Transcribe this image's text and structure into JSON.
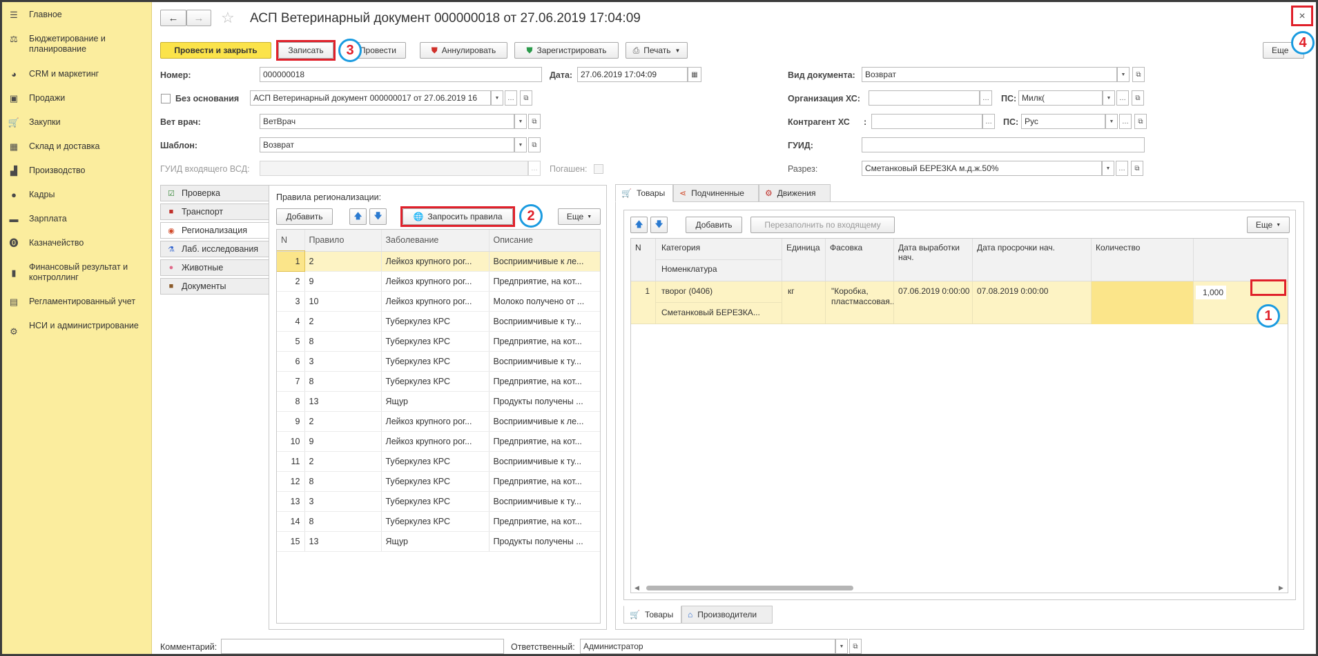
{
  "sidebar": {
    "items": [
      {
        "label": "Главное",
        "icon": "menu-icon"
      },
      {
        "label": "Бюджетирование и планирование",
        "icon": "budget-icon"
      },
      {
        "label": "CRM и маркетинг",
        "icon": "crm-icon"
      },
      {
        "label": "Продажи",
        "icon": "sales-icon"
      },
      {
        "label": "Закупки",
        "icon": "cart-icon"
      },
      {
        "label": "Склад и доставка",
        "icon": "warehouse-icon"
      },
      {
        "label": "Производство",
        "icon": "factory-icon"
      },
      {
        "label": "Кадры",
        "icon": "personnel-icon"
      },
      {
        "label": "Зарплата",
        "icon": "salary-icon"
      },
      {
        "label": "Казначейство",
        "icon": "treasury-icon"
      },
      {
        "label": "Финансовый результат и контроллинг",
        "icon": "finance-icon"
      },
      {
        "label": "Регламентированный учет",
        "icon": "accounting-icon"
      },
      {
        "label": "НСИ и администрирование",
        "icon": "gear-icon"
      }
    ]
  },
  "header": {
    "title": "АСП Ветеринарный документ 000000018 от 27.06.2019 17:04:09",
    "close": "×"
  },
  "toolbar": {
    "post_close": "Провести и закрыть",
    "save": "Записать",
    "post": "Провести",
    "annul": "Аннулировать",
    "register": "Зарегистрировать",
    "print": "Печать",
    "more": "Еще"
  },
  "form": {
    "number_label": "Номер:",
    "number": "000000018",
    "date_label": "Дата:",
    "date": "27.06.2019 17:04:09",
    "no_basis_label": "Без основания",
    "basis": "АСП Ветеринарный документ 000000017 от 27.06.2019 16",
    "vet_label": "Вет врач:",
    "vet": "ВетВрач",
    "template_label": "Шаблон:",
    "template": "Возврат",
    "guid_in_label": "ГУИД входящего ВСД:",
    "guid_in": "",
    "paid_label": "Погашен:",
    "doc_type_label": "Вид документа:",
    "doc_type": "Возврат",
    "org_label": "Организация ХС:",
    "org": "",
    "ps_label": "ПС:",
    "org_ps": "Милк(",
    "contr_label": "Контрагент ХС",
    "contr_colon": ":",
    "contr": "",
    "contr_ps": "Рус",
    "guid_label": "ГУИД:",
    "guid": "",
    "cut_label": "Разрез:",
    "cut": "Сметанковый БЕРЕЗКА м.д.ж.50%",
    "comment_label": "Комментарий:",
    "comment": "",
    "resp_label": "Ответственный:",
    "resp": "Администратор"
  },
  "left_tabs": [
    {
      "label": "Проверка",
      "icon": "check-icon",
      "color": "#3a8a3a"
    },
    {
      "label": "Транспорт",
      "icon": "truck-icon",
      "color": "#c0302a"
    },
    {
      "label": "Регионализация",
      "icon": "map-pin-icon",
      "color": "#d04a2a"
    },
    {
      "label": "Лаб. исследования",
      "icon": "flask-icon",
      "color": "#3a6ad0"
    },
    {
      "label": "Животные",
      "icon": "pig-icon",
      "color": "#e06a8a"
    },
    {
      "label": "Документы",
      "icon": "briefcase-icon",
      "color": "#8a5a2a"
    }
  ],
  "rules": {
    "title": "Правила регионализации:",
    "add": "Добавить",
    "request": "Запросить правила",
    "more": "Еще",
    "columns": [
      "N",
      "Правило",
      "Заболевание",
      "Описание"
    ],
    "rows": [
      [
        "1",
        "2",
        "Лейкоз крупного рог...",
        "Восприимчивые к ле..."
      ],
      [
        "2",
        "9",
        "Лейкоз крупного рог...",
        "Предприятие, на кот..."
      ],
      [
        "3",
        "10",
        "Лейкоз крупного рог...",
        "Молоко получено от ..."
      ],
      [
        "4",
        "2",
        "Туберкулез КРС",
        "Восприимчивые к ту..."
      ],
      [
        "5",
        "8",
        "Туберкулез КРС",
        "Предприятие, на кот..."
      ],
      [
        "6",
        "3",
        "Туберкулез КРС",
        "Восприимчивые к ту..."
      ],
      [
        "7",
        "8",
        "Туберкулез КРС",
        "Предприятие, на кот..."
      ],
      [
        "8",
        "13",
        "Ящур",
        "Продукты получены ..."
      ],
      [
        "9",
        "2",
        "Лейкоз крупного рог...",
        "Восприимчивые к ле..."
      ],
      [
        "10",
        "9",
        "Лейкоз крупного рог...",
        "Предприятие, на кот..."
      ],
      [
        "11",
        "2",
        "Туберкулез КРС",
        "Восприимчивые к ту..."
      ],
      [
        "12",
        "8",
        "Туберкулез КРС",
        "Предприятие, на кот..."
      ],
      [
        "13",
        "3",
        "Туберкулез КРС",
        "Восприимчивые к ту..."
      ],
      [
        "14",
        "8",
        "Туберкулез КРС",
        "Предприятие, на кот..."
      ],
      [
        "15",
        "13",
        "Ящур",
        "Продукты получены ..."
      ]
    ]
  },
  "right_tabs": [
    "Товары",
    "Подчиненные",
    "Движения"
  ],
  "goods": {
    "add": "Добавить",
    "refill": "Перезаполнить по входящему",
    "more": "Еще",
    "columns": {
      "n": "N",
      "category": "Категория",
      "nomenclature": "Номенклатура",
      "unit": "Единица",
      "pack": "Фасовка",
      "prod_date": "Дата выработки нач.",
      "exp_date": "Дата просрочки нач.",
      "qty": "Количество"
    },
    "row": {
      "n": "1",
      "category": "творог (0406)",
      "nomenclature": "Сметанковый БЕРЕЗКА...",
      "unit": "кг",
      "pack": "\"Коробка, пластмассовая...",
      "prod_date": "07.06.2019 0:00:00",
      "exp_date": "07.08.2019 0:00:00",
      "qty": "1,000"
    }
  },
  "bottom_tabs": [
    "Товары",
    "Производители"
  ],
  "markers": [
    "1",
    "2",
    "3",
    "4"
  ]
}
